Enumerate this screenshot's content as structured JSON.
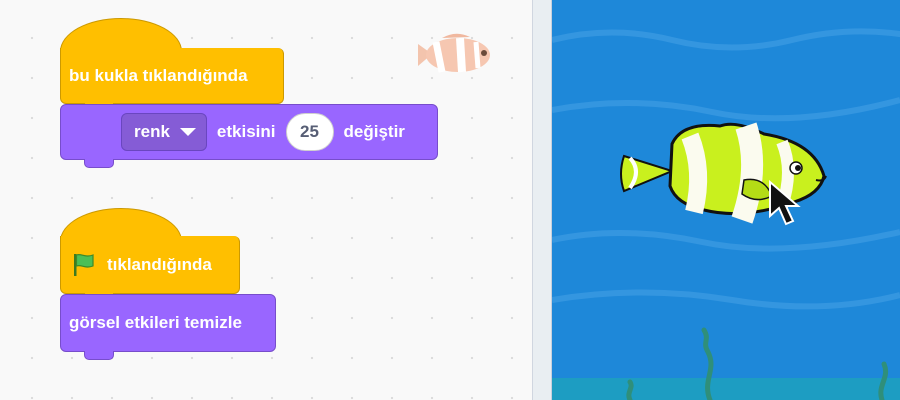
{
  "code_area": {
    "script1": {
      "hat_label": "bu kukla tıklandığında",
      "command": {
        "dropdown_value": "renk",
        "text_before": "etkisini",
        "value": "25",
        "text_after": "değiştir"
      }
    },
    "script2": {
      "hat_label": "tıklandığında",
      "command_label": "görsel etkileri temizle"
    }
  },
  "colors": {
    "events": "#ffbf00",
    "looks": "#9966ff",
    "stage_water": "#1e88d9",
    "fish_body": "#c9f01e"
  },
  "icons": [
    "green-flag-icon",
    "dropdown-arrow-icon",
    "mouse-cursor-icon",
    "clownfish-sprite-thumbnail",
    "clownfish-sprite"
  ]
}
